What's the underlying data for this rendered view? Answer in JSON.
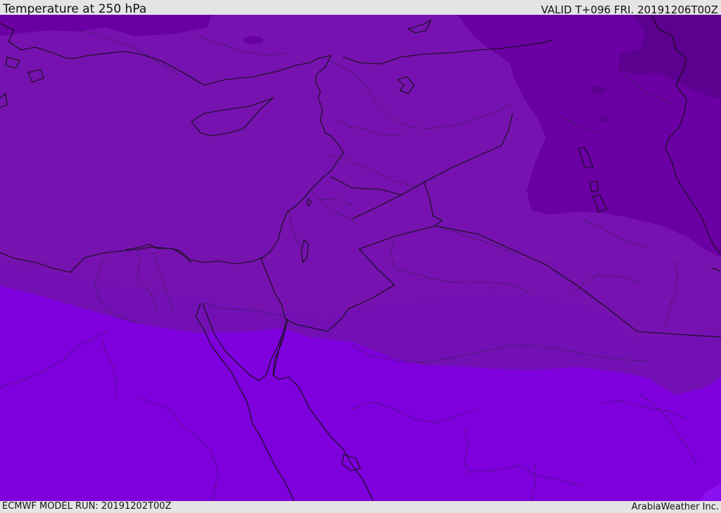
{
  "header": {
    "title": "Temperature at 250 hPa",
    "valid": "VALID T+096 FRI. 20191206T00Z"
  },
  "footer": {
    "model_run": "ECMWF MODEL RUN: 20191202T00Z",
    "credit": "ArabiaWeather Inc."
  },
  "map": {
    "field": "temperature",
    "level": "250 hPa",
    "colors": {
      "coldest": "#5c0090",
      "cold": "#6a00a4",
      "mid": "#7612b0",
      "warm": "#7e00dc",
      "warmest": "#8a10f0"
    }
  }
}
